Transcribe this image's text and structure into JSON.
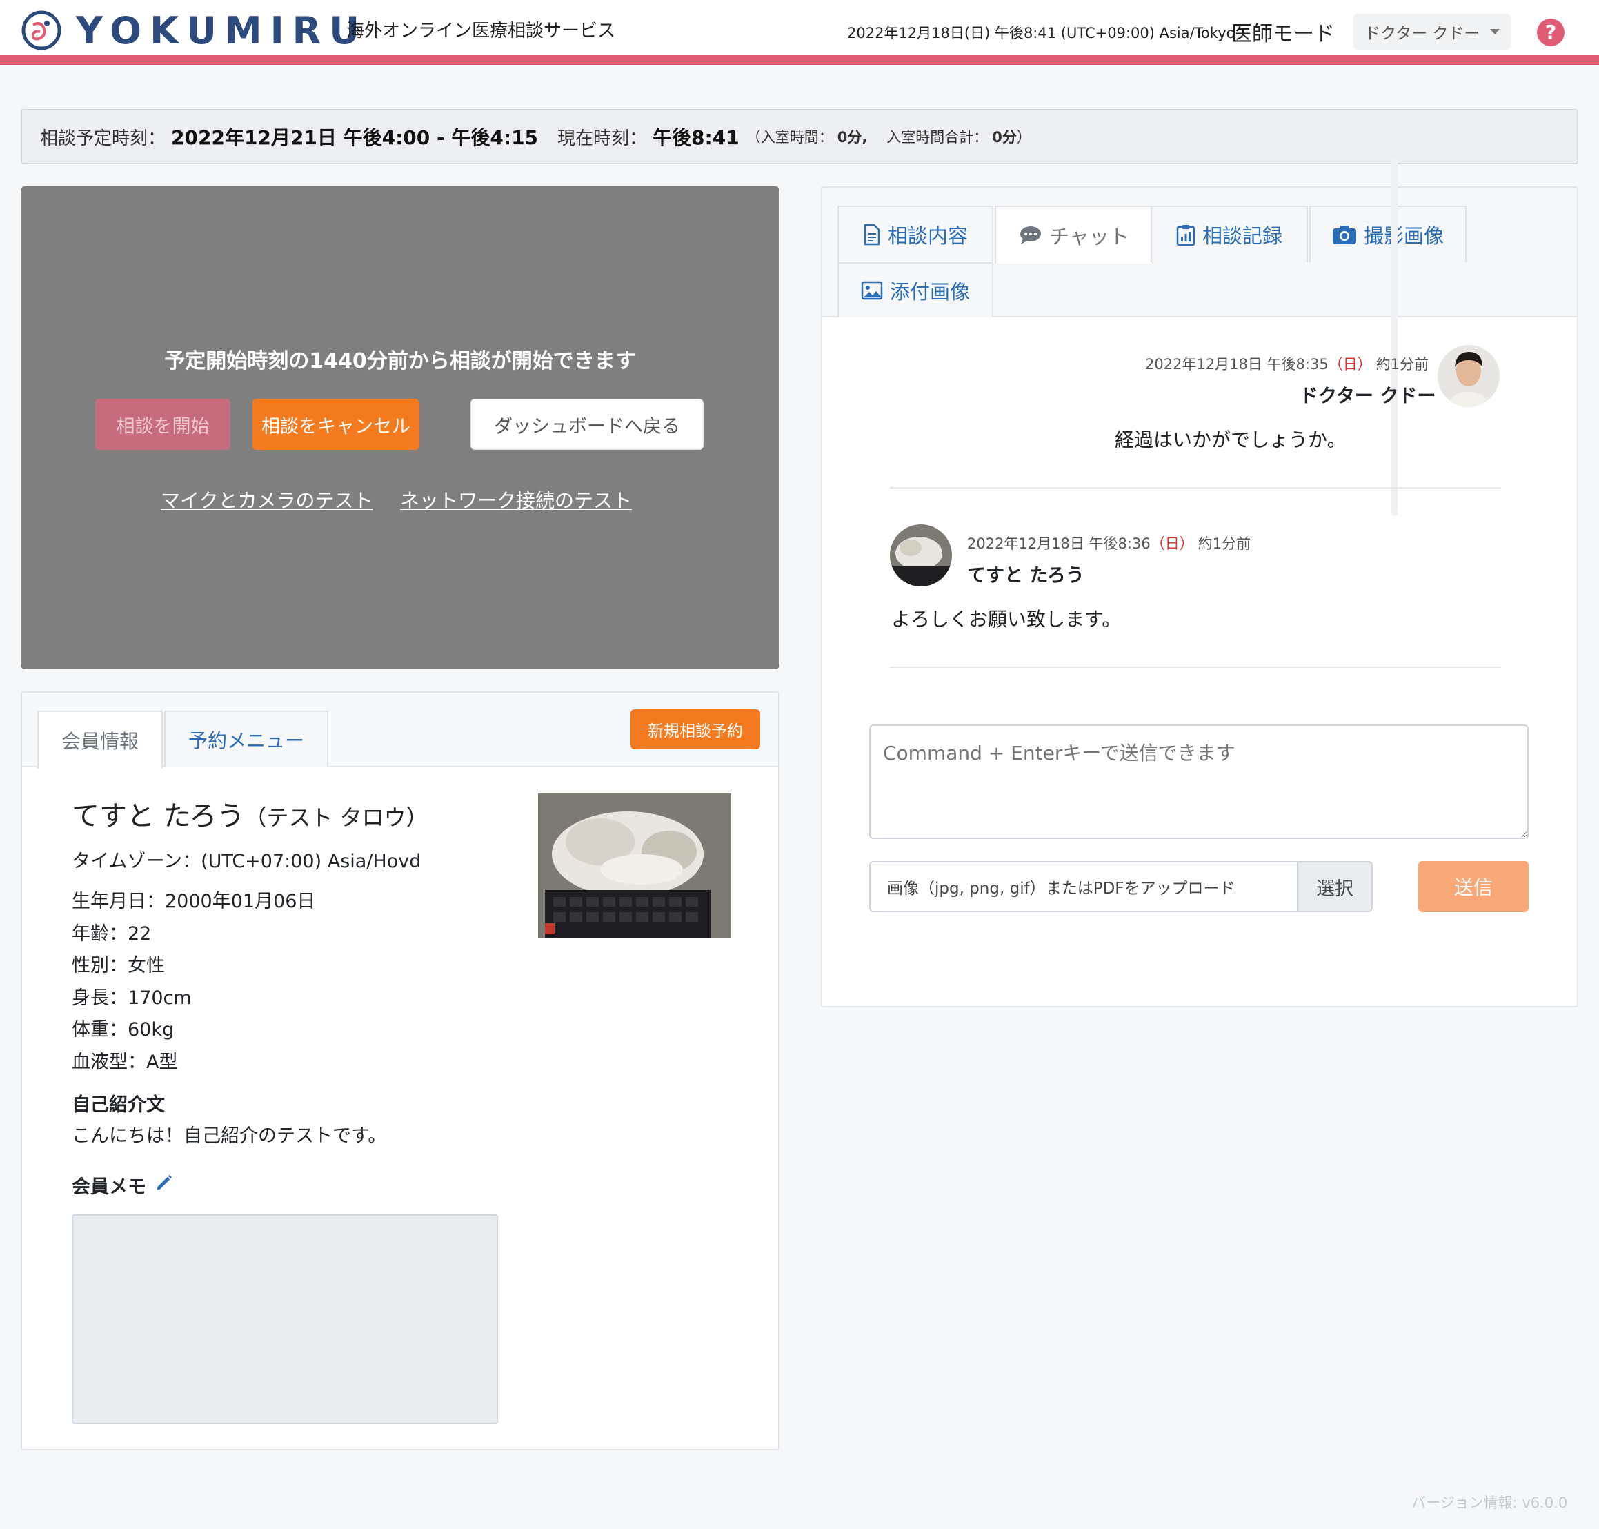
{
  "header": {
    "logo_text": "YOKUMIRU",
    "tagline": "海外オンライン医療相談サービス",
    "datetime": "2022年12月18日(日) 午後8:41 (UTC+09:00) Asia/Tokyo",
    "mode": "医師モード",
    "user_menu": "ドクター クドー",
    "help": "?",
    "accent_color": "#e05c74"
  },
  "schedule": {
    "label": "相談予定時刻：",
    "value": "2022年12月21日 午後4:00 - 午後4:15",
    "current_label": "現在時刻：",
    "current_value": "午後8:41",
    "open_paren": "（",
    "entry_label": "入室時間：",
    "entry_value": "0分,",
    "total_label": "入室時間合計：",
    "total_value": "0分",
    "close_paren": "）"
  },
  "video": {
    "message": "予定開始時刻の1440分前から相談が開始できます",
    "start_button": "相談を開始",
    "cancel_button": "相談をキャンセル",
    "dashboard_button": "ダッシュボードへ戻る",
    "mic_test_link": "マイクとカメラのテスト",
    "network_test_link": "ネットワーク接続のテスト"
  },
  "member": {
    "tabs": [
      "会員情報",
      "予約メニュー"
    ],
    "new_booking_button": "新規相談予約",
    "name": "てすと たろう",
    "name_kana": "（テスト タロウ）",
    "timezone": "タイムゾーン：(UTC+07:00) Asia/Hovd",
    "details": [
      "生年月日：2000年01月06日",
      "年齢：22",
      "性別：女性",
      "身長：170cm",
      "体重：60kg",
      "血液型：A型"
    ],
    "bio_label": "自己紹介文",
    "bio_text": "こんにちは！自己紹介のテストです。",
    "memo_label": "会員メモ"
  },
  "right_tabs": [
    "相談内容",
    "チャット",
    "相談記録",
    "撮影画像",
    "添付画像"
  ],
  "chat": {
    "messages": [
      {
        "date": "2022年12月18日 午後8:35",
        "day": "（日）",
        "ago": "約1分前",
        "name": "ドクター クドー",
        "text": "経過はいかがでしょうか。"
      },
      {
        "date": "2022年12月18日 午後8:36",
        "day": "（日）",
        "ago": "約1分前",
        "name": "てすと たろう",
        "text": "よろしくお願い致します。"
      }
    ],
    "input_placeholder": "Command + Enterキーで送信できます",
    "upload_placeholder": "画像（jpg, png, gif）またはPDFをアップロード",
    "select_button": "選択",
    "send_button": "送信"
  },
  "footer": {
    "version": "バージョン情報: v6.0.0"
  }
}
